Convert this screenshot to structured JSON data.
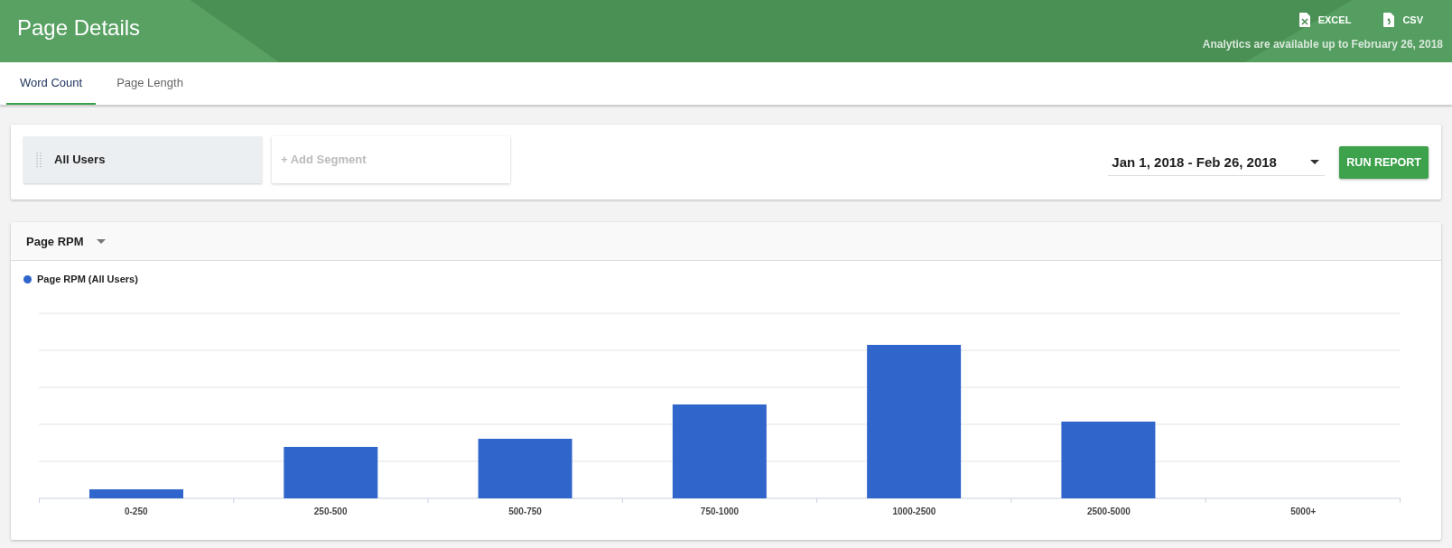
{
  "header": {
    "title": "Page Details",
    "exports": [
      {
        "kind": "excel",
        "label": "EXCEL"
      },
      {
        "kind": "csv",
        "label": "CSV"
      }
    ],
    "note": "Analytics are available up to February 26, 2018"
  },
  "tabs": [
    {
      "label": "Word Count",
      "selected": true
    },
    {
      "label": "Page Length",
      "selected": false
    }
  ],
  "segments": {
    "items": [
      {
        "label": "All Users"
      }
    ],
    "add_label": "+ Add Segment"
  },
  "date_range": {
    "value": "Jan 1, 2018 - Feb 26, 2018"
  },
  "run_button": "RUN REPORT",
  "chart_panel": {
    "metric": "Page RPM",
    "legend": "Page RPM (All Users)",
    "x_labels": [
      "0-250",
      "250-500",
      "500-750",
      "750-1000",
      "1000-2500",
      "2500-5000",
      "5000+"
    ]
  }
}
